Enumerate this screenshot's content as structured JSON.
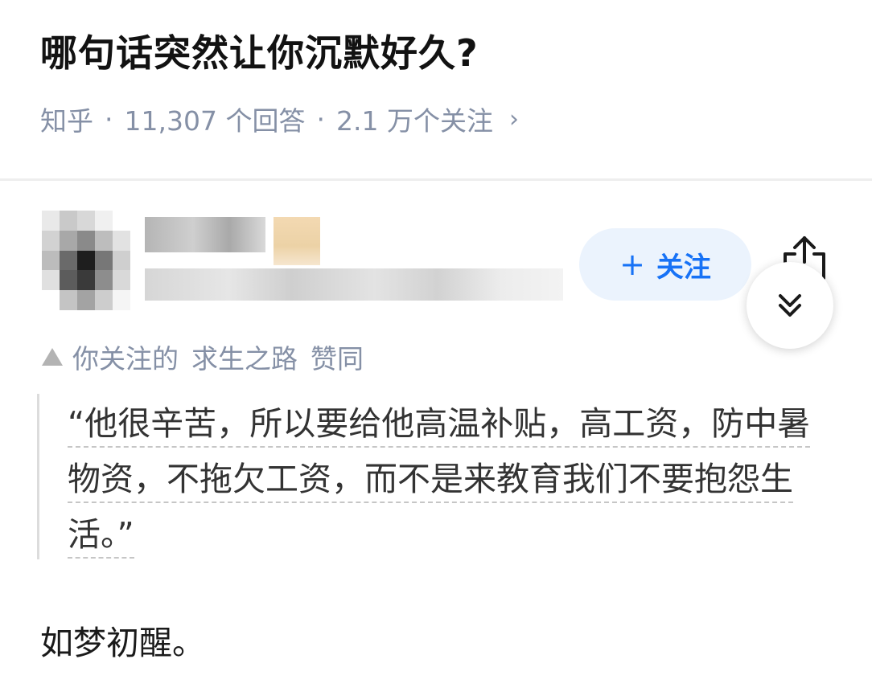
{
  "question": {
    "title": "哪句话突然让你沉默好久?",
    "source": "知乎",
    "answers": "11,307 个回答",
    "followers": "2.1 万个关注",
    "chevron": "›"
  },
  "author": {
    "follow_plus": "+",
    "follow_label": "关注"
  },
  "voter": {
    "prefix": "你关注的",
    "name": "求生之路",
    "action": "赞同"
  },
  "answer": {
    "quote": "“他很辛苦，所以要给他高温补贴，高工资，防中暑物资，不拖欠工资，而不是来教育我们不要抱怨生活。”",
    "conclusion": "如梦初醒。"
  },
  "colors": {
    "accent": "#1772f6",
    "follow_bg": "#ebf3fd",
    "meta_gray": "#8590a6"
  },
  "icons": {
    "share": "share-icon",
    "collapse": "double-chevron-down-icon",
    "upvote": "triangle-up-icon"
  }
}
